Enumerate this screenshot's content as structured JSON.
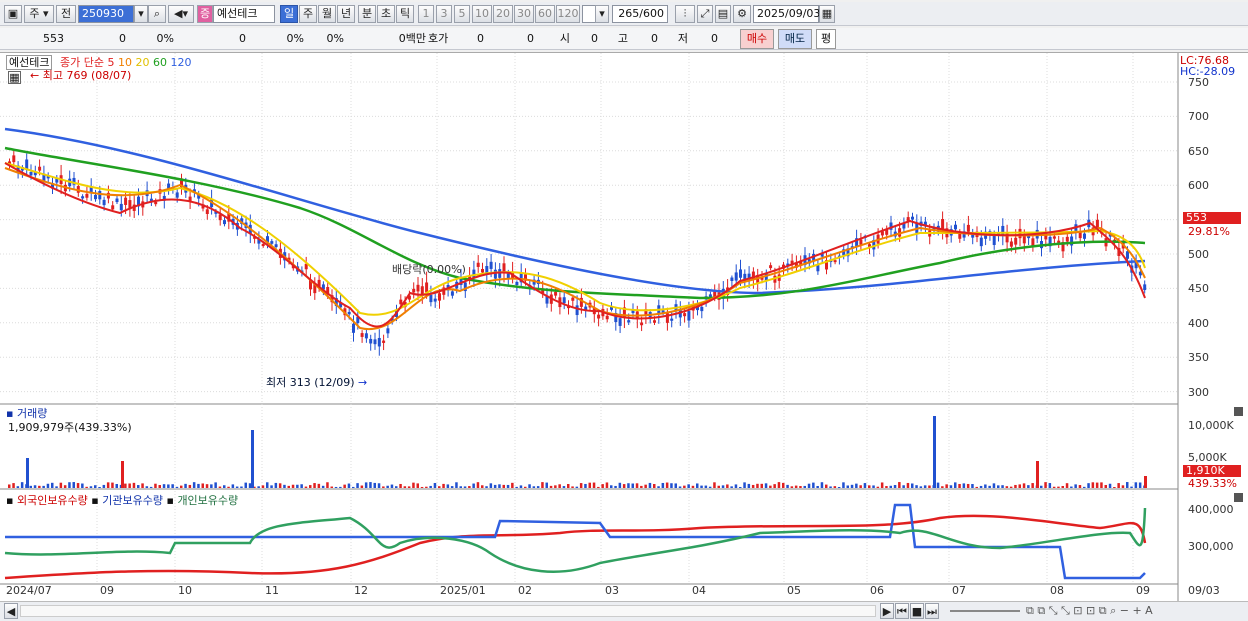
{
  "toolbar": {
    "market": "주",
    "prev": "전",
    "code": "250930",
    "badge": "증",
    "name": "예선테크",
    "periods": [
      "일",
      "주",
      "월",
      "년",
      "분",
      "초",
      "틱"
    ],
    "numbers": [
      "1",
      "3",
      "5",
      "10",
      "20",
      "30",
      "60",
      "120"
    ],
    "count": "265",
    "count_max": "/600",
    "date": "2025/09/03"
  },
  "quote": {
    "price": "553",
    "change": "0",
    "change_pct": "0%",
    "volume": "0",
    "vol_pct": "0%",
    "pct2": "0%",
    "amount": "0백만",
    "hoga_label": "호가",
    "hoga1": "0",
    "hoga2": "0",
    "si_label": "시",
    "si": "0",
    "go_label": "고",
    "go": "0",
    "jeo_label": "저",
    "jeo": "0",
    "buy": "매수",
    "sell": "매도",
    "eval": "평"
  },
  "price_panel": {
    "name": "예선테크",
    "ma_label": "종가 단순",
    "ma_periods": [
      "5",
      "10",
      "20",
      "60",
      "120"
    ],
    "ma_colors": [
      "#e02020",
      "#f08000",
      "#f0d000",
      "#20a020",
      "#3060e0"
    ],
    "high_label": "최고 769 (08/07)",
    "low_label": "최저 313 (12/09)",
    "dividend_label": "배당락(0.00%)",
    "lc": "LC:76.68",
    "hc": "HC:-28.09",
    "y_ticks": [
      "750",
      "700",
      "650",
      "600",
      "550",
      "500",
      "450",
      "400",
      "350",
      "300"
    ],
    "current_price": "553",
    "current_pct": "29.81%"
  },
  "volume_panel": {
    "title": "거래량",
    "value": "1,909,979주(439.33%)",
    "y_ticks": [
      "10,000K",
      "5,000K"
    ],
    "current": "1,910K",
    "current_pct": "439.33%"
  },
  "holding_panel": {
    "legend": [
      "외국인보유수량",
      "기관보유수량",
      "개인보유수량"
    ],
    "colors": [
      "#e02020",
      "#3060e0",
      "#30a060"
    ],
    "y_ticks": [
      "400,000",
      "300,000"
    ]
  },
  "x_labels": [
    "2024/07",
    "09",
    "10",
    "11",
    "12",
    "2025/01",
    "02",
    "03",
    "04",
    "05",
    "06",
    "07",
    "08",
    "09",
    "09/03"
  ]
}
